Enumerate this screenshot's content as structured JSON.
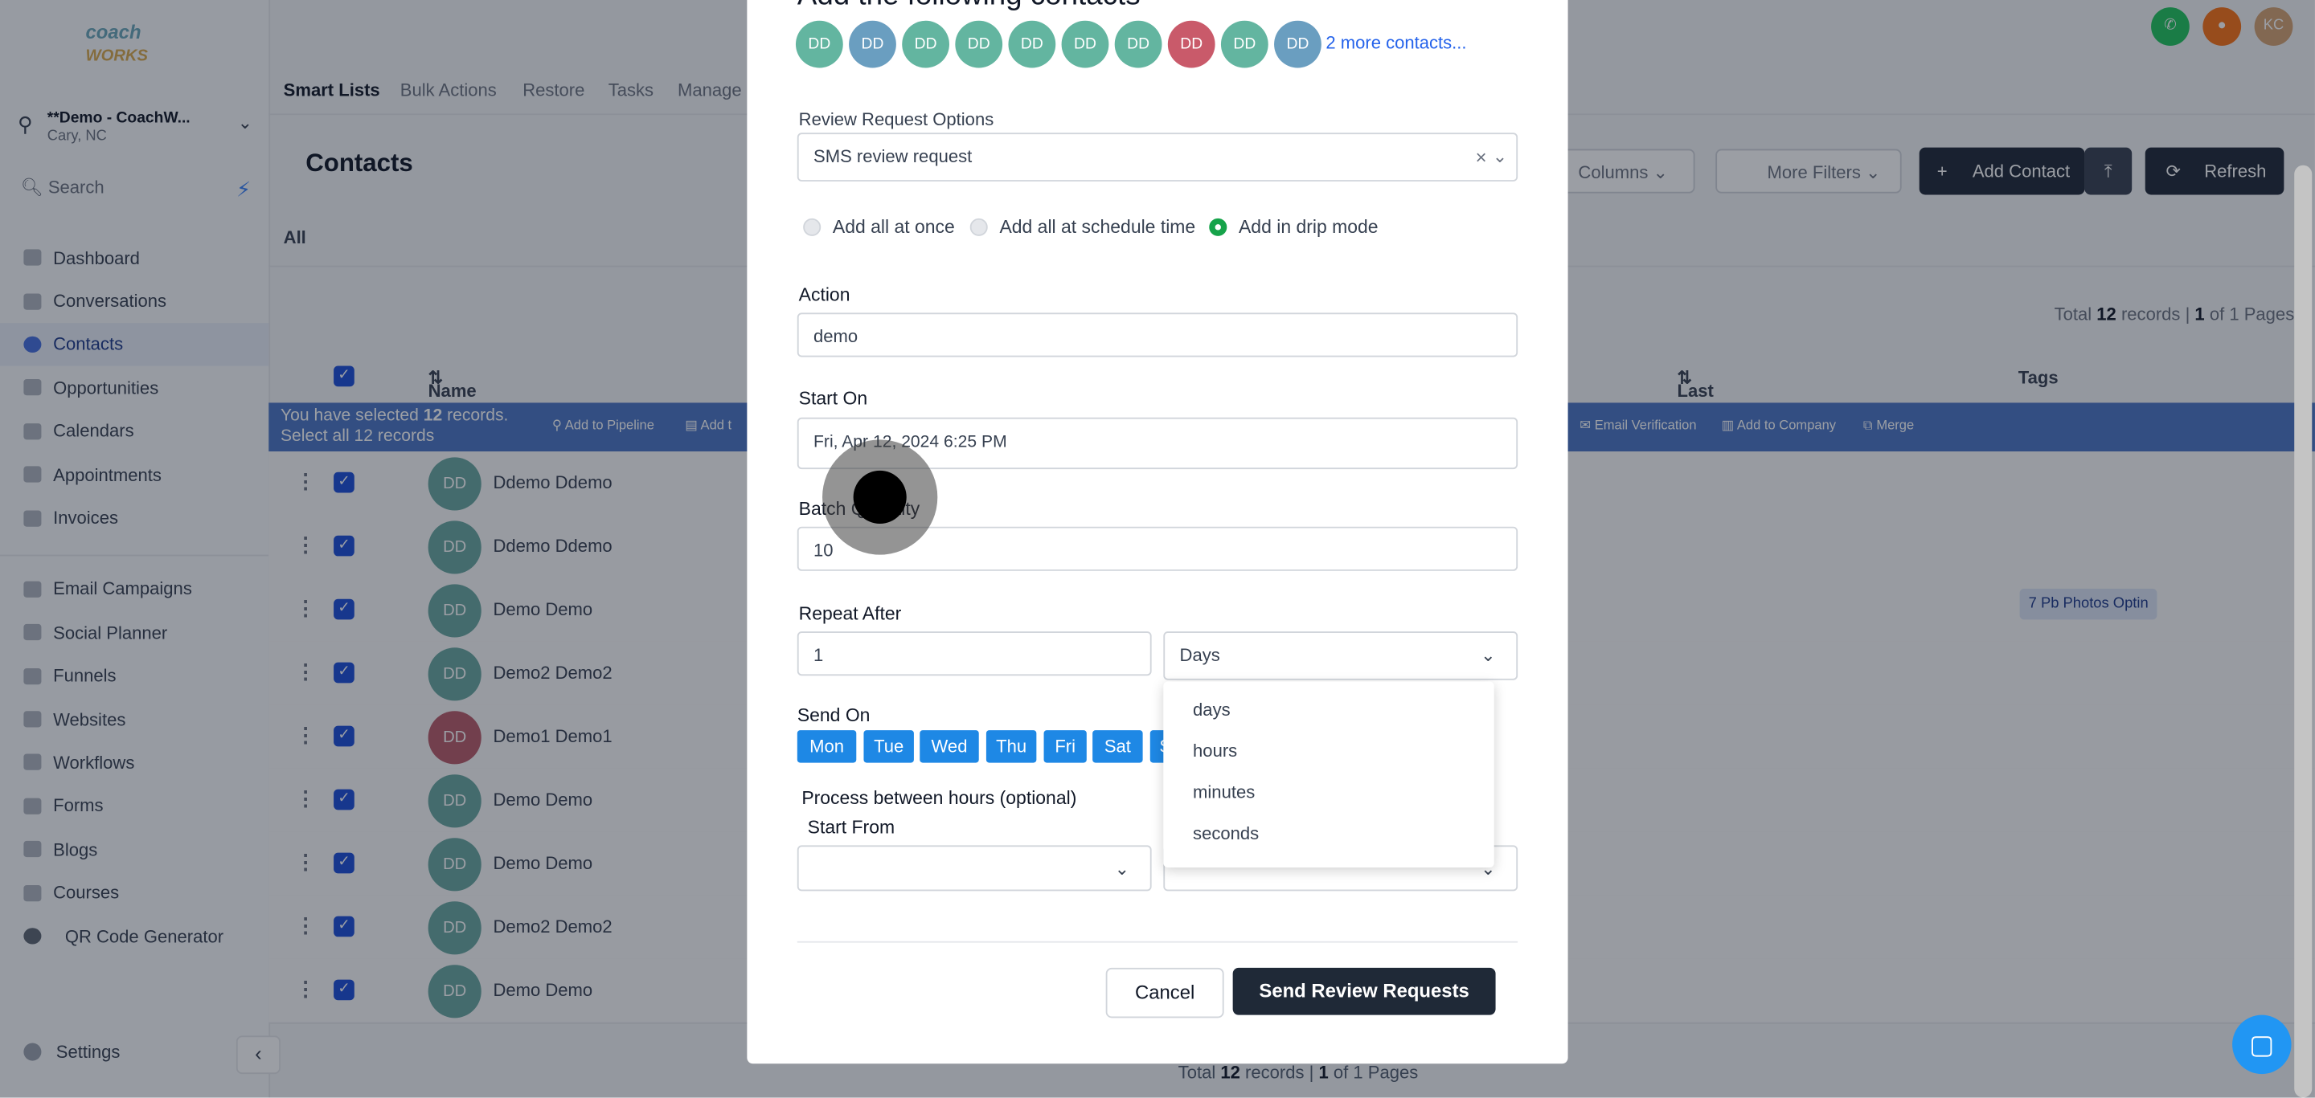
{
  "sidebar": {
    "logo_top": "coach",
    "logo_bottom": "WORKS",
    "location_name": "**Demo - CoachW...",
    "location_sub": "Cary, NC",
    "search_placeholder": "Search",
    "items": [
      {
        "label": "Dashboard"
      },
      {
        "label": "Conversations"
      },
      {
        "label": "Contacts"
      },
      {
        "label": "Opportunities"
      },
      {
        "label": "Calendars"
      },
      {
        "label": "Appointments"
      },
      {
        "label": "Invoices"
      }
    ],
    "items2": [
      {
        "label": "Email Campaigns"
      },
      {
        "label": "Social Planner"
      },
      {
        "label": "Funnels"
      },
      {
        "label": "Websites"
      },
      {
        "label": "Workflows"
      },
      {
        "label": "Forms"
      },
      {
        "label": "Blogs"
      },
      {
        "label": "Courses"
      },
      {
        "label": "QR Code Generator"
      }
    ],
    "settings": "Settings"
  },
  "topnav": {
    "tabs": [
      "Smart Lists",
      "Bulk Actions",
      "Restore",
      "Tasks",
      "Manage"
    ],
    "user_initials": "KC"
  },
  "contacts": {
    "title": "Contacts",
    "columns_btn": "Columns",
    "more_filters_btn": "More Filters",
    "add_contact_btn": "Add Contact",
    "refresh_btn": "Refresh",
    "all_tab": "All",
    "total_top": {
      "pre": "Total ",
      "count": "12",
      "mid": " records | ",
      "page": "1",
      "post": " of 1 Pages"
    },
    "headers": {
      "name": "Name",
      "last_activity": "Last Activity",
      "tags": "Tags"
    },
    "selection": {
      "line1_pre": "You have selected ",
      "line1_count": "12",
      "line1_post": " records.",
      "line2": "Select all 12 records",
      "actions": [
        "Add to Pipeline",
        "Add t",
        "Email Verification",
        "Add to Company",
        "Merge"
      ]
    },
    "rows": [
      {
        "initials": "DD",
        "name": "Ddemo Ddemo",
        "color": "#6aa8a0",
        "tag": ""
      },
      {
        "initials": "DD",
        "name": "Ddemo Ddemo",
        "color": "#6aa8a0",
        "tag": ""
      },
      {
        "initials": "DD",
        "name": "Demo Demo",
        "color": "#6aa8a0",
        "tag": "7 Pb Photos Optin"
      },
      {
        "initials": "DD",
        "name": "Demo2 Demo2",
        "color": "#6aa8a0",
        "tag": ""
      },
      {
        "initials": "DD",
        "name": "Demo1 Demo1",
        "color": "#b85c6a",
        "tag": ""
      },
      {
        "initials": "DD",
        "name": "Demo Demo",
        "color": "#6aa8a0",
        "tag": ""
      },
      {
        "initials": "DD",
        "name": "Demo Demo",
        "color": "#6aa8a0",
        "tag": ""
      },
      {
        "initials": "DD",
        "name": "Demo2 Demo2",
        "color": "#6aa8a0",
        "tag": ""
      },
      {
        "initials": "DD",
        "name": "Demo Demo",
        "color": "#6aa8a0",
        "tag": ""
      }
    ],
    "footer_total": {
      "pre": "Total ",
      "count": "12",
      "mid": " records | ",
      "page": "1",
      "post": " of 1 Pages"
    }
  },
  "modal": {
    "title": "Add the following contacts",
    "avatars": [
      {
        "initials": "DD",
        "color": "#63b5a0"
      },
      {
        "initials": "DD",
        "color": "#6a9ec0"
      },
      {
        "initials": "DD",
        "color": "#63b5a0"
      },
      {
        "initials": "DD",
        "color": "#63b5a0"
      },
      {
        "initials": "DD",
        "color": "#63b5a0"
      },
      {
        "initials": "DD",
        "color": "#63b5a0"
      },
      {
        "initials": "DD",
        "color": "#63b5a0"
      },
      {
        "initials": "DD",
        "color": "#c95a6a"
      },
      {
        "initials": "DD",
        "color": "#63b5a0"
      },
      {
        "initials": "DD",
        "color": "#6a9ec0"
      }
    ],
    "more_contacts": "2 more contacts...",
    "review_label": "Review Request Options",
    "review_value": "SMS review request",
    "radios": [
      {
        "label": "Add all at once",
        "selected": false
      },
      {
        "label": "Add all at schedule time",
        "selected": false
      },
      {
        "label": "Add in drip mode",
        "selected": true
      }
    ],
    "action_label": "Action",
    "action_value": "demo",
    "start_label": "Start On",
    "start_value": "Fri, Apr 12, 2024 6:25 PM",
    "batch_label": "Batch Quantity",
    "batch_value": "10",
    "repeat_label": "Repeat After",
    "repeat_value": "1",
    "repeat_unit": "Days",
    "unit_options": [
      "days",
      "hours",
      "minutes",
      "seconds"
    ],
    "send_on_label": "Send On",
    "days": [
      "Mon",
      "Tue",
      "Wed",
      "Thu",
      "Fri",
      "Sat",
      "Sun"
    ],
    "process_label": "Process between hours (optional)",
    "start_from_label": "Start From",
    "cancel_btn": "Cancel",
    "send_btn": "Send Review Requests"
  },
  "colors": {
    "accent": "#1e88e5",
    "dark": "#1f2937",
    "drip_green": "#16a34a"
  }
}
